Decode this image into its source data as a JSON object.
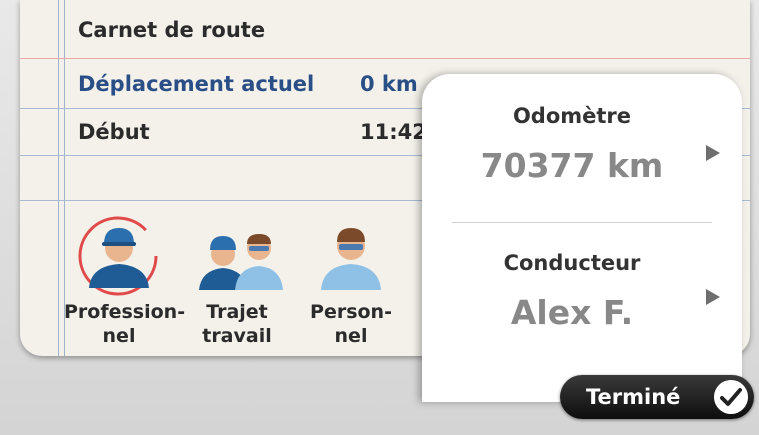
{
  "logbook": {
    "title": "Carnet de route",
    "current_trip_label": "Déplacement actuel",
    "current_trip_value": "0 km",
    "start_label": "Début",
    "start_value": "11:42",
    "drivers": [
      {
        "label": "Profession-\nnel",
        "selected": true
      },
      {
        "label": "Trajet\ntravail",
        "selected": false
      },
      {
        "label": "Person-\nnel",
        "selected": false
      }
    ]
  },
  "panel": {
    "odometer_label": "Odomètre",
    "odometer_value": "70377 km",
    "driver_label": "Conducteur",
    "driver_value": "Alex F."
  },
  "done_button": {
    "label": "Terminé"
  },
  "colors": {
    "accent_blue": "#2a4f86",
    "selection_ring": "#e04a4a",
    "cap_blue": "#2b6fae"
  },
  "icons": [
    "professional-driver-icon",
    "commute-trip-icon",
    "personal-driver-icon",
    "chevron-right-icon",
    "checkmark-icon"
  ]
}
